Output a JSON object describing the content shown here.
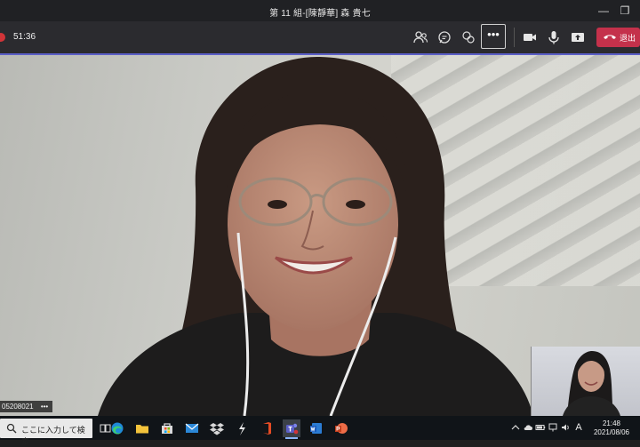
{
  "window": {
    "title": "第 11 組-[陳靜華] 森 貴七",
    "minimize_glyph": "—",
    "maximize_glyph": "❐"
  },
  "meeting": {
    "timer": "51:36",
    "more_glyph": "•••",
    "leave_label": "退出",
    "toolbar_icons": [
      "people-icon",
      "chat-icon",
      "reactions-icon",
      "more-options-icon",
      "camera-icon",
      "microphone-icon",
      "share-screen-icon",
      "phone-hangup-icon"
    ],
    "participant_label": "05208021",
    "participant_more": "•••",
    "colors": {
      "accent": "#5b5fc7",
      "leave": "#c4314b",
      "recording": "#d13438"
    }
  },
  "taskbar": {
    "search_placeholder": "ここに入力して検索",
    "apps": [
      "task-view-icon",
      "edge-icon",
      "file-explorer-icon",
      "store-icon",
      "mail-icon",
      "dropbox-icon",
      "app-s-icon",
      "office-icon",
      "teams-icon",
      "word-icon",
      "powerpoint-icon"
    ],
    "tray_icons": [
      "chevron-up-icon",
      "cloud-icon",
      "battery-icon",
      "network-icon",
      "volume-icon",
      "ime-icon"
    ],
    "ime_label": "A",
    "time": "21:48",
    "date": "2021/08/06"
  }
}
